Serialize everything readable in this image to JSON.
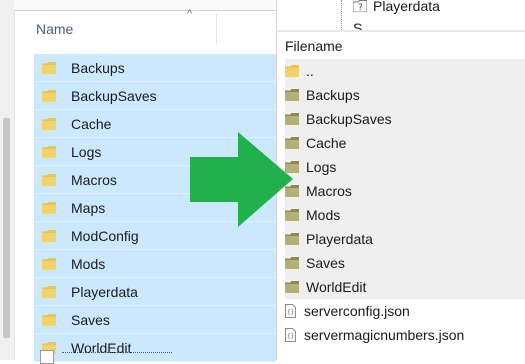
{
  "left_pane": {
    "column_header": "Name",
    "sort_indicator": "^",
    "folders": [
      {
        "label": "Backups"
      },
      {
        "label": "BackupSaves"
      },
      {
        "label": "Cache"
      },
      {
        "label": "Logs"
      },
      {
        "label": "Macros"
      },
      {
        "label": "Maps"
      },
      {
        "label": "ModConfig"
      },
      {
        "label": "Mods"
      },
      {
        "label": "Playerdata"
      },
      {
        "label": "Saves"
      },
      {
        "label": "WorldEdit"
      }
    ],
    "folder_color": "#e8c64f",
    "selection_color": "#cce8ff"
  },
  "right_pane": {
    "tree": {
      "item_label": "Playerdata",
      "item_partial": "S..."
    },
    "column_header": "Filename",
    "parent_entry": "..",
    "folders": [
      {
        "label": "Backups"
      },
      {
        "label": "BackupSaves"
      },
      {
        "label": "Cache"
      },
      {
        "label": "Logs"
      },
      {
        "label": "Macros"
      },
      {
        "label": "Mods"
      },
      {
        "label": "Playerdata"
      },
      {
        "label": "Saves"
      },
      {
        "label": "WorldEdit"
      }
    ],
    "files": [
      {
        "label": "serverconfig.json",
        "icon": "json-file-icon"
      },
      {
        "label": "servermagicnumbers.json",
        "icon": "json-file-icon"
      }
    ],
    "folder_color": "#b5b079",
    "row_highlight": "#efefef"
  },
  "arrow": {
    "icon": "arrow-right-icon",
    "color": "#21b04b"
  }
}
